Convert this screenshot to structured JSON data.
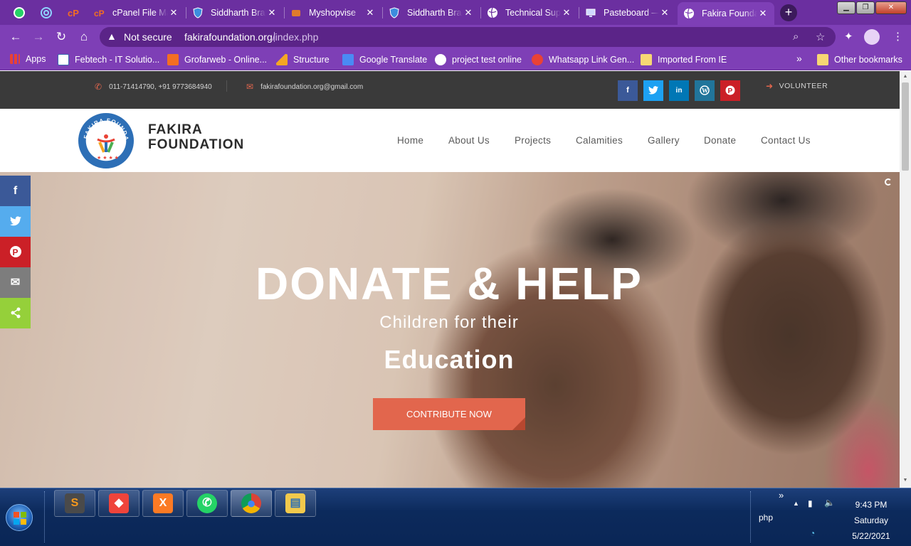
{
  "browser": {
    "tabs": [
      {
        "title": "cPanel File Manager",
        "color": "#f36e22"
      },
      {
        "title": "Siddharth Bramhe",
        "color": "#3c8dde"
      },
      {
        "title": "Myshopvise",
        "color": "#e07a2c"
      },
      {
        "title": "Siddharth Bramhe",
        "color": "#3c8dde"
      },
      {
        "title": "Technical Support",
        "color": "#ffffff"
      },
      {
        "title": "Pasteboard —",
        "color": "#cfd8ff"
      },
      {
        "title": "Fakira Foundation",
        "color": "#ffffff"
      }
    ],
    "new_tab": "+",
    "security_label": "Not secure",
    "url_host": "fakirafoundation.org",
    "url_path": "/index.php"
  },
  "bookmarks": {
    "items": [
      {
        "label": "Apps",
        "color": "#e94235"
      },
      {
        "label": "Febtech - IT Solutio...",
        "color": "#ffffff"
      },
      {
        "label": "Grofarweb - Online...",
        "color": "#f36e22"
      },
      {
        "label": "Structure",
        "color": "#f5a623"
      },
      {
        "label": "Google Translate",
        "color": "#4a8af4"
      },
      {
        "label": "project test online",
        "color": "#ffffff"
      },
      {
        "label": "Whatsapp Link Gen...",
        "color": "#e94235"
      },
      {
        "label": "Imported From IE",
        "color": "#f7d774"
      }
    ],
    "more": "»",
    "other": "Other bookmarks"
  },
  "topbar": {
    "phone": "011-71414790, +91 9773684940",
    "email": "fakirafoundation.org@gmail.com",
    "volunteer": "VOLUNTEER",
    "social": [
      {
        "name": "facebook",
        "glyph": "f",
        "color": "#3b5998"
      },
      {
        "name": "twitter",
        "glyph": "t",
        "color": "#1da1f2"
      },
      {
        "name": "linkedin",
        "glyph": "in",
        "color": "#0077b5"
      },
      {
        "name": "wordpress",
        "glyph": "W",
        "color": "#21759b"
      },
      {
        "name": "pinterest",
        "glyph": "P",
        "color": "#cb2027"
      }
    ]
  },
  "site": {
    "brand_line1": "FAKIRA",
    "brand_line2": "FOUNDATION",
    "logo_text": "FAKIRA FOUNDATION",
    "nav": [
      "Home",
      "About Us",
      "Projects",
      "Calamities",
      "Gallery",
      "Donate",
      "Contact Us"
    ]
  },
  "hero": {
    "title": "DONATE & HELP",
    "subtitle": "Children for their",
    "highlight": "Education",
    "cta": "CONTRIBUTE NOW"
  },
  "share_bar": [
    {
      "name": "facebook",
      "glyph": "f",
      "color": "#3b5998"
    },
    {
      "name": "twitter",
      "glyph": "t",
      "color": "#55acee"
    },
    {
      "name": "pinterest",
      "glyph": "P",
      "color": "#cb2027"
    },
    {
      "name": "email",
      "glyph": "✉",
      "color": "#7d7d7d"
    },
    {
      "name": "share",
      "glyph": "<",
      "color": "#95d03a"
    }
  ],
  "taskbar": {
    "apps": [
      {
        "name": "sublime-text",
        "glyph": "S",
        "color": "#f89a1c"
      },
      {
        "name": "anydesk",
        "glyph": "◆",
        "color": "#ef443b"
      },
      {
        "name": "xampp",
        "glyph": "X",
        "color": "#fb7a24"
      },
      {
        "name": "whatsapp",
        "glyph": "✆",
        "color": "#25d366"
      },
      {
        "name": "chrome",
        "glyph": "●",
        "color": "#4285f4"
      },
      {
        "name": "file-explorer",
        "glyph": "▤",
        "color": "#f2c94c"
      }
    ],
    "tray_label": "php",
    "time": "9:43 PM",
    "day": "Saturday",
    "date": "5/22/2021"
  }
}
